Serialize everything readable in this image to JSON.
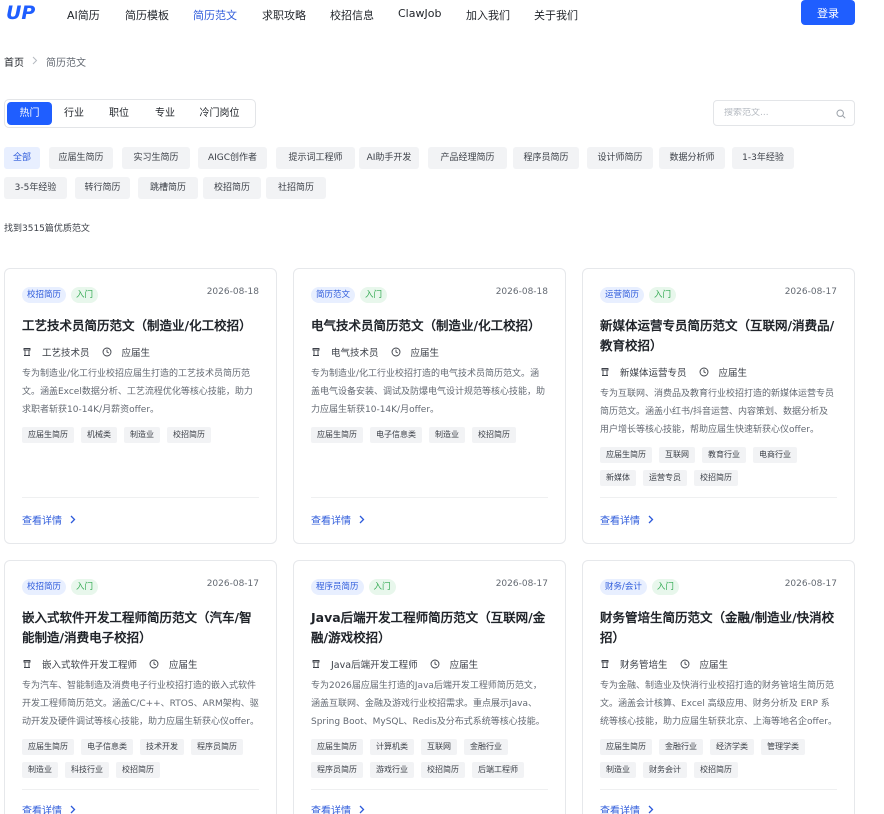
{
  "header": {
    "logo_text": "UP",
    "nav": [
      {
        "label": "AI简历",
        "active": false
      },
      {
        "label": "简历模板",
        "active": false
      },
      {
        "label": "简历范文",
        "active": true
      },
      {
        "label": "求职攻略",
        "active": false
      },
      {
        "label": "校招信息",
        "active": false
      },
      {
        "label": "ClawJob",
        "active": false
      },
      {
        "label": "加入我们",
        "active": false
      },
      {
        "label": "关于我们",
        "active": false
      }
    ],
    "login_label": "登录"
  },
  "breadcrumb": {
    "home": "首页",
    "current": "简历范文"
  },
  "tabs": [
    {
      "label": "热门",
      "active": true
    },
    {
      "label": "行业",
      "active": false
    },
    {
      "label": "职位",
      "active": false
    },
    {
      "label": "专业",
      "active": false
    },
    {
      "label": "冷门岗位",
      "active": false
    }
  ],
  "search": {
    "placeholder": "搜索范文..."
  },
  "chips": [
    {
      "label": "全部",
      "active": true
    },
    {
      "label": "应届生简历",
      "active": false
    },
    {
      "label": "实习生简历",
      "active": false
    },
    {
      "label": "AIGC创作者",
      "active": false
    },
    {
      "label": "提示词工程师",
      "active": false
    },
    {
      "label": "AI助手开发",
      "active": false
    },
    {
      "label": "产品经理简历",
      "active": false
    },
    {
      "label": "程序员简历",
      "active": false
    },
    {
      "label": "设计师简历",
      "active": false
    },
    {
      "label": "数据分析师",
      "active": false
    },
    {
      "label": "1-3年经验",
      "active": false
    },
    {
      "label": "3-5年经验",
      "active": false
    },
    {
      "label": "转行简历",
      "active": false
    },
    {
      "label": "跳槽简历",
      "active": false
    },
    {
      "label": "校招简历",
      "active": false
    },
    {
      "label": "社招简历",
      "active": false
    }
  ],
  "result_count": "找到3515篇优质范文",
  "cards": [
    {
      "category": "校招简历",
      "level": "入门",
      "date": "2026-08-18",
      "title": "工艺技术员简历范文（制造业/化工校招）",
      "position": "工艺技术员",
      "experience": "应届生",
      "desc": "专为制造业/化工行业校招应届生打造的工艺技术员简历范文。涵盖Excel数据分析、工艺流程优化等核心技能，助力求职者斩获10-14K/月薪资offer。",
      "tags": [
        "应届生简历",
        "机械类",
        "制造业",
        "校招简历"
      ],
      "more": "查看详情"
    },
    {
      "category": "简历范文",
      "level": "入门",
      "date": "2026-08-18",
      "title": "电气技术员简历范文（制造业/化工校招）",
      "position": "电气技术员",
      "experience": "应届生",
      "desc": "专为制造业/化工行业校招打造的电气技术员简历范文。涵盖电气设备安装、调试及防爆电气设计规范等核心技能，助力应届生斩获10-14K/月offer。",
      "tags": [
        "应届生简历",
        "电子信息类",
        "制造业",
        "校招简历"
      ],
      "more": "查看详情"
    },
    {
      "category": "运营简历",
      "level": "入门",
      "date": "2026-08-17",
      "title": "新媒体运营专员简历范文（互联网/消费品/教育校招）",
      "position": "新媒体运营专员",
      "experience": "应届生",
      "desc": "专为互联网、消费品及教育行业校招打造的新媒体运营专员简历范文。涵盖小红书/抖音运营、内容策划、数据分析及用户增长等核心技能，帮助应届生快速斩获心仪offer。",
      "tags": [
        "应届生简历",
        "互联网",
        "教育行业",
        "电商行业",
        "新媒体",
        "运营专员",
        "校招简历"
      ],
      "more": "查看详情"
    },
    {
      "category": "校招简历",
      "level": "入门",
      "date": "2026-08-17",
      "title": "嵌入式软件开发工程师简历范文（汽车/智能制造/消费电子校招）",
      "position": "嵌入式软件开发工程师",
      "experience": "应届生",
      "desc": "专为汽车、智能制造及消费电子行业校招打造的嵌入式软件开发工程师简历范文。涵盖C/C++、RTOS、ARM架构、驱动开发及硬件调试等核心技能，助力应届生斩获心仪offer。",
      "tags": [
        "应届生简历",
        "电子信息类",
        "技术开发",
        "程序员简历",
        "制造业",
        "科技行业",
        "校招简历"
      ],
      "more": "查看详情"
    },
    {
      "category": "程序员简历",
      "level": "入门",
      "date": "2026-08-17",
      "title": "Java后端开发工程师简历范文（互联网/金融/游戏校招）",
      "position": "Java后端开发工程师",
      "experience": "应届生",
      "desc": "专为2026届应届生打造的Java后端开发工程师简历范文，涵盖互联网、金融及游戏行业校招需求。重点展示Java、Spring Boot、MySQL、Redis及分布式系统等核心技能。",
      "tags": [
        "应届生简历",
        "计算机类",
        "互联网",
        "金融行业",
        "程序员简历",
        "游戏行业",
        "校招简历",
        "后端工程师"
      ],
      "more": "查看详情"
    },
    {
      "category": "财务/会计",
      "level": "入门",
      "date": "2026-08-17",
      "title": "财务管培生简历范文（金融/制造业/快消校招）",
      "position": "财务管培生",
      "experience": "应届生",
      "desc": "专为金融、制造业及快消行业校招打造的财务管培生简历范文。涵盖会计核算、Excel 高级应用、财务分析及 ERP 系统等核心技能，助力应届生斩获北京、上海等地名企offer。",
      "tags": [
        "应届生简历",
        "金融行业",
        "经济学类",
        "管理学类",
        "制造业",
        "财务会计",
        "校招简历"
      ],
      "more": "查看详情"
    }
  ]
}
